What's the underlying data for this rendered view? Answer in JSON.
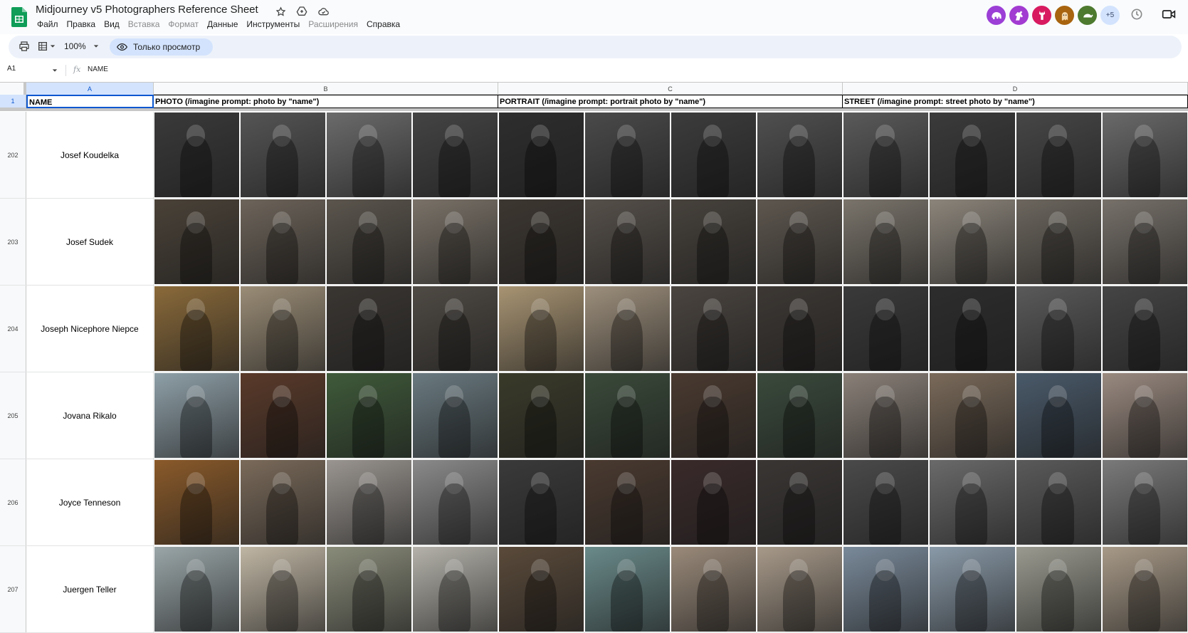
{
  "document": {
    "title": "Midjourney v5 Photographers Reference Sheet"
  },
  "menu": [
    {
      "label": "Файл",
      "disabled": false
    },
    {
      "label": "Правка",
      "disabled": false
    },
    {
      "label": "Вид",
      "disabled": false
    },
    {
      "label": "Вставка",
      "disabled": true
    },
    {
      "label": "Формат",
      "disabled": true
    },
    {
      "label": "Данные",
      "disabled": false
    },
    {
      "label": "Инструменты",
      "disabled": false
    },
    {
      "label": "Расширения",
      "disabled": true
    },
    {
      "label": "Справка",
      "disabled": false
    }
  ],
  "collaborators": {
    "avatars": [
      {
        "icon": "elephant-icon",
        "color": "#9b3fd6"
      },
      {
        "icon": "horse-icon",
        "color": "#a23bd1"
      },
      {
        "icon": "deer-icon",
        "color": "#d81b60"
      },
      {
        "icon": "ghost-icon",
        "color": "#a8640f"
      },
      {
        "icon": "turtle-icon",
        "color": "#4d7a2f"
      }
    ],
    "more_label": "+5"
  },
  "toolbar": {
    "zoom": "100%",
    "mode_label": "Только просмотр"
  },
  "formula_bar": {
    "cell_ref": "A1",
    "value": "NAME"
  },
  "grid": {
    "columns": [
      "A",
      "B",
      "C",
      "D"
    ],
    "header_row_number": "1",
    "headers": {
      "name": "NAME",
      "photo": "PHOTO (/imagine prompt: photo by \"name\")",
      "portrait": "PORTRAIT (/imagine prompt: portrait photo by \"name\")",
      "street": "STREET (/imagine prompt: street photo by \"name\")"
    },
    "rows": [
      {
        "number": "202",
        "name": "Josef Koudelka",
        "palettes": {
          "photo": [
            "#3a3a3a",
            "#555",
            "#6b6b6b",
            "#444"
          ],
          "portrait": [
            "#2e2e2e",
            "#4a4a4a",
            "#3c3c3c",
            "#505050"
          ],
          "street": [
            "#5a5a5a",
            "#3b3b3b",
            "#474747",
            "#6a6a6a"
          ]
        }
      },
      {
        "number": "203",
        "name": "Josef Sudek",
        "palettes": {
          "photo": [
            "#4a4238",
            "#6d645a",
            "#5b554d",
            "#7a7268"
          ],
          "portrait": [
            "#3d3731",
            "#56504a",
            "#47423c",
            "#5e574f"
          ],
          "street": [
            "#7a746b",
            "#8c857b",
            "#6c665e",
            "#77716a"
          ]
        }
      },
      {
        "number": "204",
        "name": "Joseph Nicephore Niepce",
        "palettes": {
          "photo": [
            "#8a6a3a",
            "#9b8d77",
            "#3a3632",
            "#4f4a44"
          ],
          "portrait": [
            "#a89473",
            "#9d8f7c",
            "#4b4540",
            "#3d3834"
          ],
          "street": [
            "#3a3a3a",
            "#2d2d2d",
            "#5a5a5a",
            "#454545"
          ]
        }
      },
      {
        "number": "205",
        "name": "Jovana Rikalo",
        "palettes": {
          "photo": [
            "#8fa0a8",
            "#5a3a2a",
            "#3f5a3a",
            "#6a7a80"
          ],
          "portrait": [
            "#3a3a2a",
            "#3a4a3a",
            "#4a3a30",
            "#3a4a3c"
          ],
          "street": [
            "#8a8078",
            "#7a6a5a",
            "#4a5a6a",
            "#9a8a80"
          ]
        }
      },
      {
        "number": "206",
        "name": "Joyce Tenneson",
        "palettes": {
          "photo": [
            "#8a5a2a",
            "#7a6a5a",
            "#9a9590",
            "#8a8a8a"
          ],
          "portrait": [
            "#3a3a3a",
            "#4a3a30",
            "#3a2a2a",
            "#3a3634"
          ],
          "street": [
            "#4a4a4a",
            "#6a6a6a",
            "#5a5a5a",
            "#7a7a7a"
          ]
        }
      },
      {
        "number": "207",
        "name": "Juergen Teller",
        "palettes": {
          "photo": [
            "#9aa6a8",
            "#c0b6a4",
            "#8a8c7a",
            "#b4b2aa"
          ],
          "portrait": [
            "#5a4a3a",
            "#6a8a8a",
            "#9a8a7a",
            "#a89a8a"
          ],
          "street": [
            "#7a8a9a",
            "#8a9aa8",
            "#9a9a90",
            "#a89a88"
          ]
        }
      }
    ]
  }
}
